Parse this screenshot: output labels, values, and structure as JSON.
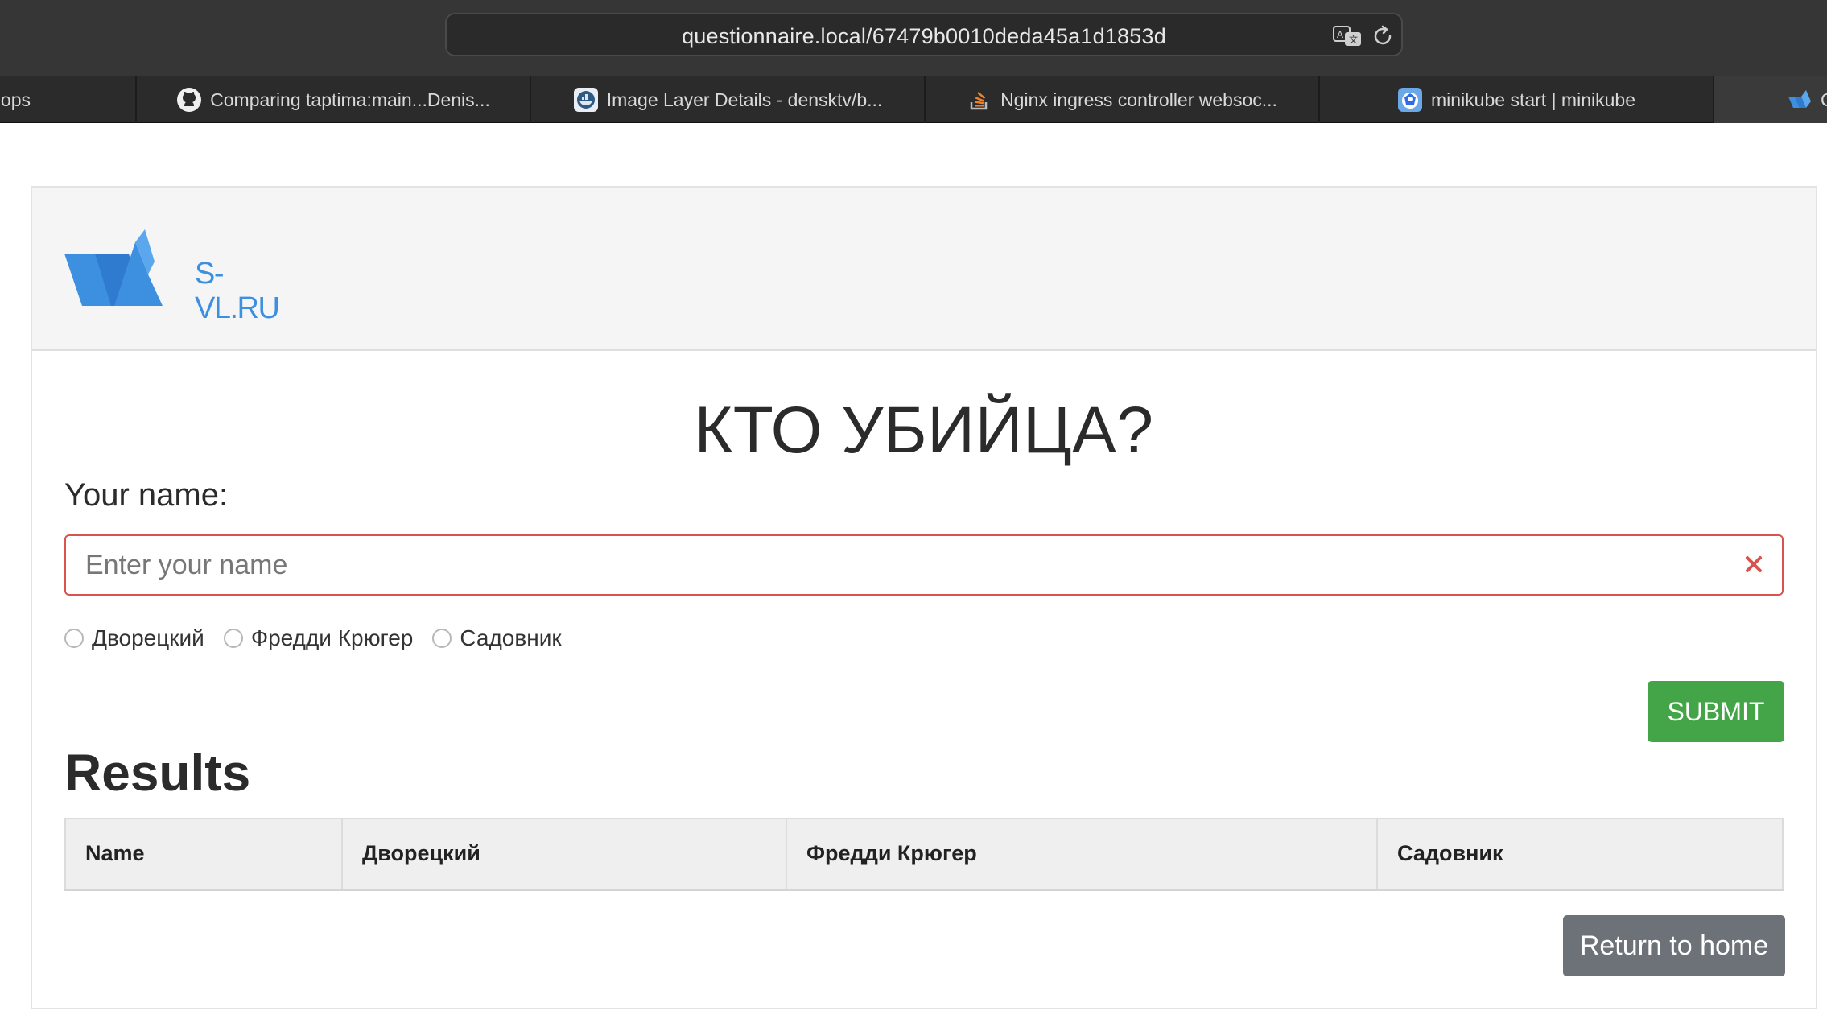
{
  "browser": {
    "url": "questionnaire.local/67479b0010deda45a1d1853d",
    "tabs": [
      {
        "label": "ops",
        "icon": "none"
      },
      {
        "label": "Comparing taptima:main...Denis...",
        "icon": "github-icon"
      },
      {
        "label": "Image Layer Details - densktv/b...",
        "icon": "docker-icon"
      },
      {
        "label": "Nginx ingress controller websoc...",
        "icon": "stackoverflow-icon"
      },
      {
        "label": "minikube start | minikube",
        "icon": "minikube-icon"
      },
      {
        "label": "C",
        "icon": "svl-logo-icon"
      }
    ]
  },
  "header": {
    "logo_text": "S-VL.RU"
  },
  "form": {
    "title": "КТО УБИЙЦА?",
    "name_label": "Your name:",
    "name_placeholder": "Enter your name",
    "name_value": "",
    "options": [
      "Дворецкий",
      "Фредди Крюгер",
      "Садовник"
    ],
    "submit_label": "SUBMIT"
  },
  "results": {
    "heading": "Results",
    "columns": [
      "Name",
      "Дворецкий",
      "Фредди Крюгер",
      "Садовник"
    ],
    "rows": []
  },
  "return_label": "Return to home",
  "colors": {
    "submit": "#43a547",
    "error_border": "#d9534f",
    "return_button": "#6c7278",
    "logo_blue": "#3d8fe0"
  }
}
